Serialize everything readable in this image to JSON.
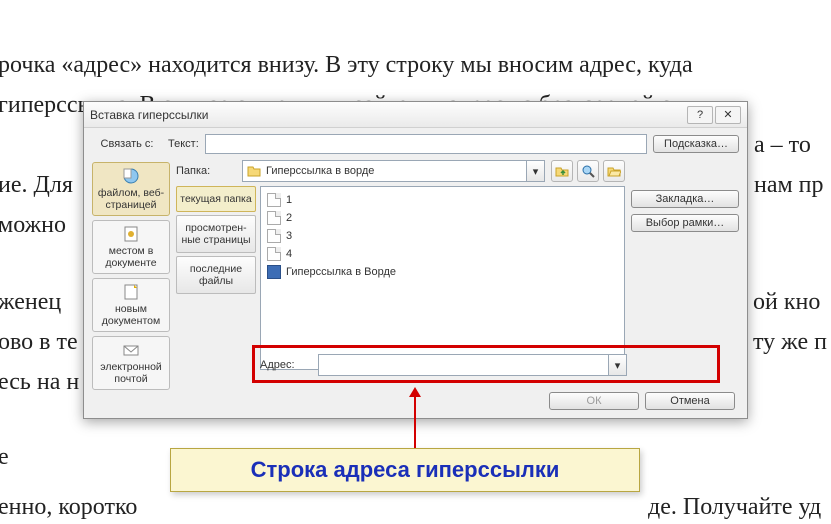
{
  "background": {
    "l1": "рочка «адрес» находится внизу. В эту строку мы вносим адрес, куда",
    "l2": "гиперссылка. В случае с внешним сайтом – адрес из браузерной ст",
    "l3_right": "а – то",
    "l4_left": "ие. Для",
    "l4_right": "нам пр",
    "l5": "можно",
    "l6_left": "женец",
    "l6_right": "ой кно",
    "l7_left": "ово в те",
    "l7_right": "ту же п",
    "l8": "есь на н",
    "l9": "е",
    "l10_left": "енно, коротко",
    "l10_right": "де. Получайте уд"
  },
  "dialog": {
    "title": "Вставка гиперссылки",
    "link_with_label": "Связать с:",
    "text_label": "Текст:",
    "tooltip_btn": "Подсказка…",
    "left_tabs": {
      "t1": "файлом, веб-страницей",
      "t2": "местом в документе",
      "t3": "новым документом",
      "t4": "электронной почтой"
    },
    "folder_label": "Папка:",
    "folder_value": "Гиперссылка в ворде",
    "view_tabs": {
      "v1": "текущая папка",
      "v2": "просмотрен-ные страницы",
      "v3": "последние файлы"
    },
    "files": {
      "f1": "1",
      "f2": "2",
      "f3": "3",
      "f4": "4",
      "f5": "Гиперссылка в Ворде"
    },
    "bookmark_btn": "Закладка…",
    "frame_btn": "Выбор рамки…",
    "address_label": "Адрес:",
    "ok_btn": "ОК",
    "cancel_btn": "Отмена"
  },
  "callout": "Строка адреса гиперссылки"
}
